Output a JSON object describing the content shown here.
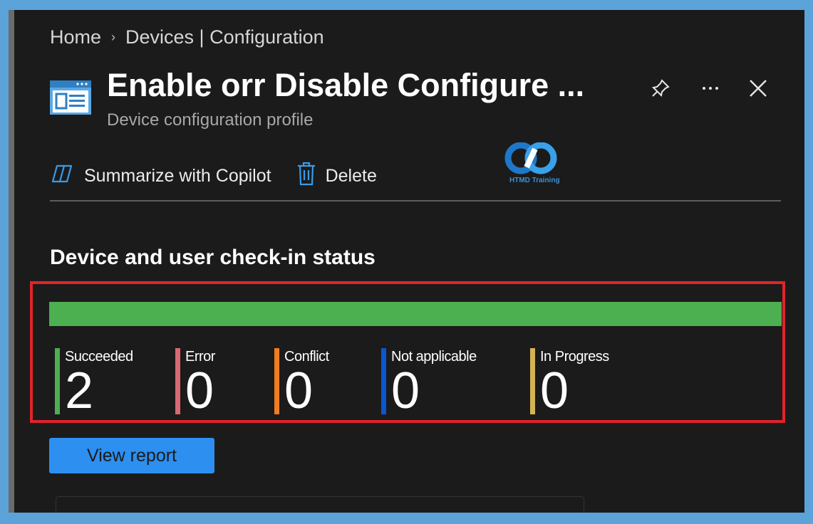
{
  "breadcrumb": {
    "home": "Home",
    "separator": "›",
    "current": "Devices | Configuration"
  },
  "header": {
    "title": "Enable orr Disable Configure ...",
    "subtitle": "Device configuration profile",
    "icon": "config-profile-icon",
    "actions": {
      "pin_icon": "pin-icon",
      "more_icon": "more-icon",
      "close_icon": "close-icon"
    }
  },
  "toolbar": {
    "copilot_label": "Summarize with Copilot",
    "delete_label": "Delete"
  },
  "watermark": {
    "text": "HTMD Training"
  },
  "status_section": {
    "title": "Device and user check-in status",
    "bar_color": "#4caf50",
    "stats": [
      {
        "label": "Succeeded",
        "value": "2",
        "color": "#4caf50"
      },
      {
        "label": "Error",
        "value": "0",
        "color": "#d86873"
      },
      {
        "label": "Conflict",
        "value": "0",
        "color": "#f07d1f"
      },
      {
        "label": "Not applicable",
        "value": "0",
        "color": "#0b57d0"
      },
      {
        "label": "In Progress",
        "value": "0",
        "color": "#d4b452"
      }
    ]
  },
  "view_report_label": "View report",
  "colors": {
    "accent": "#2d8ff0",
    "highlight": "#e2232a",
    "background": "#1b1b1b"
  }
}
